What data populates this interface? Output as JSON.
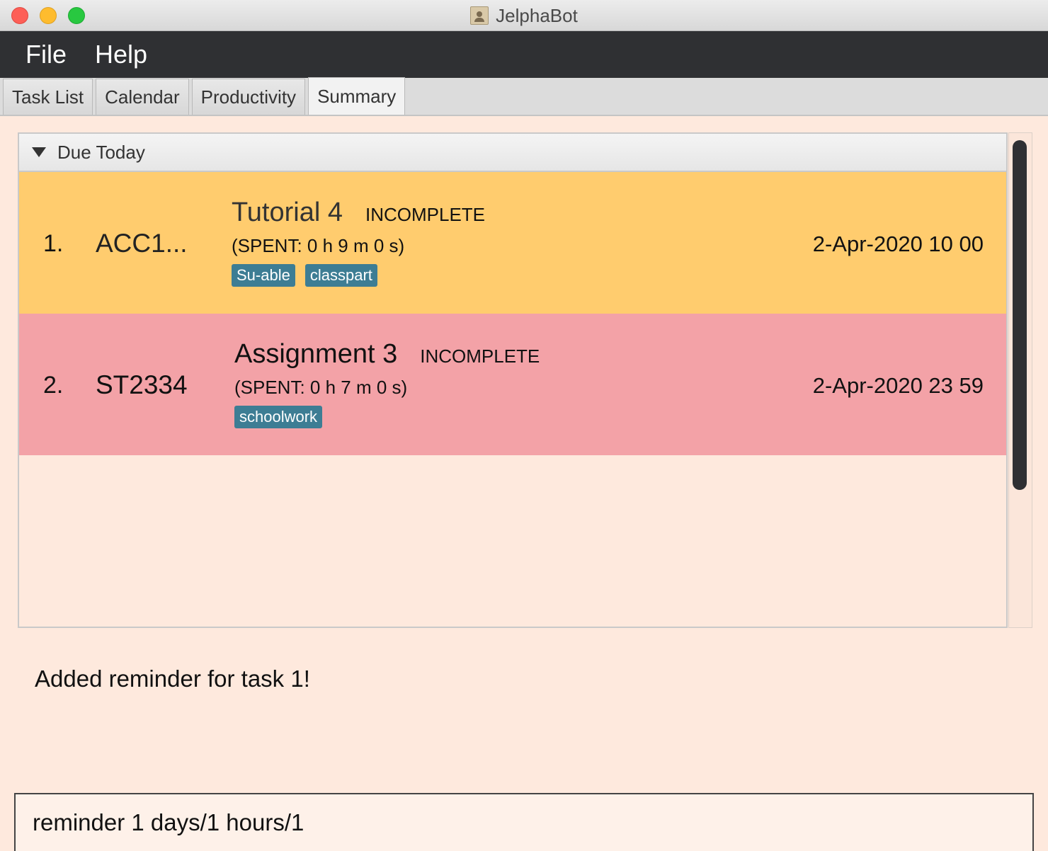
{
  "window": {
    "title": "JelphaBot"
  },
  "menu": {
    "file_label": "File",
    "help_label": "Help"
  },
  "tabs": {
    "task_list": "Task List",
    "calendar": "Calendar",
    "productivity": "Productivity",
    "summary": "Summary",
    "active": "Summary"
  },
  "group": {
    "label": "Due Today",
    "expanded": true
  },
  "tasks": [
    {
      "index": "1.",
      "module": "ACC1...",
      "name": "Tutorial 4",
      "status": "INCOMPLETE",
      "spent": "(SPENT: 0 h 9 m 0 s)",
      "tags": [
        "Su-able",
        "classpart"
      ],
      "due": "2-Apr-2020 10 00",
      "color": "#ffcc6e"
    },
    {
      "index": "2.",
      "module": "ST2334",
      "name": "Assignment 3",
      "status": "INCOMPLETE",
      "spent": "(SPENT: 0 h 7 m 0 s)",
      "tags": [
        "schoolwork"
      ],
      "due": "2-Apr-2020 23 59",
      "color": "#f3a2a7"
    }
  ],
  "result": {
    "message": "Added reminder for task 1!"
  },
  "command": {
    "value": "reminder 1 days/1 hours/1"
  },
  "colors": {
    "menubar": "#2f3033",
    "background": "#fee9dd",
    "tag": "#3d7d94"
  }
}
